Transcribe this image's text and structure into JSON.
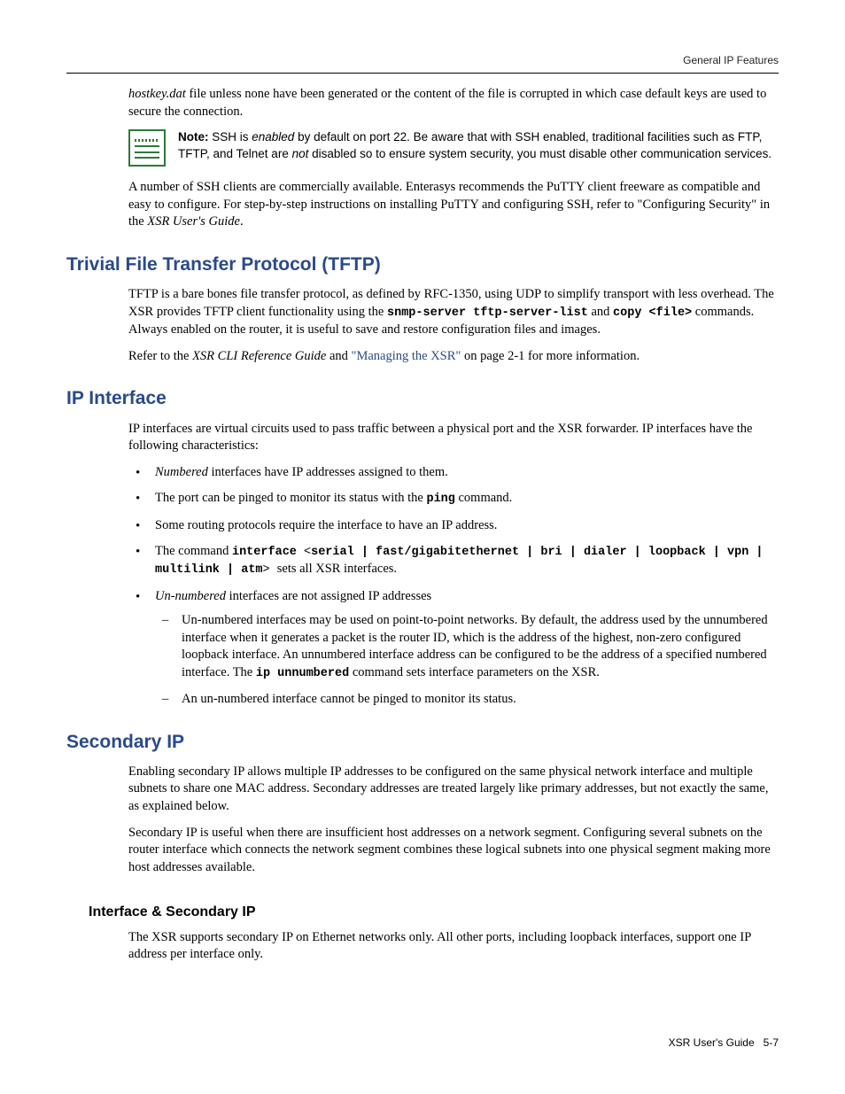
{
  "running_head": "General IP Features",
  "intro_p1_a": "hostkey.dat",
  "intro_p1_b": " file unless none have been generated or the content of the file is corrupted in which case default keys are used to secure the connection.",
  "note": {
    "label": "Note:",
    "t1": " SSH is ",
    "enabled": "enabled",
    "t2": " by default on port 22. Be aware that with SSH enabled, traditional facilities such as FTP, TFTP, and Telnet are ",
    "not": "not",
    "t3": " disabled so to ensure system security, you must disable other communication services."
  },
  "intro_p2_a": "A number of SSH clients are commercially available. Enterasys recommends the PuTTY client freeware as compatible and easy to configure. For step-by-step instructions on installing PuTTY and configuring SSH, refer to \"Configuring Security\" in the ",
  "intro_p2_b": "XSR User's Guide",
  "intro_p2_c": ".",
  "tftp": {
    "heading": "Trivial File Transfer Protocol (TFTP)",
    "p1_a": "TFTP is a bare bones file transfer protocol, as defined by RFC-1350, using UDP to simplify transport with less overhead. The XSR provides TFTP client functionality using the ",
    "p1_cmd1": "snmp-server tftp-server-list",
    "p1_b": " and ",
    "p1_cmd2": "copy <file>",
    "p1_c": " commands. Always enabled on the router, it is useful to save and restore configuration files and images.",
    "p2_a": "Refer to the ",
    "p2_b": "XSR CLI Reference Guide",
    "p2_c": " and ",
    "p2_link": "\"Managing the XSR\"",
    "p2_d": " on page 2-1 for more information."
  },
  "ipif": {
    "heading": "IP Interface",
    "p1": "IP interfaces are virtual circuits used to pass traffic between a physical port and the XSR forwarder. IP interfaces have the following characteristics:",
    "b1_a": "Numbered",
    "b1_b": " interfaces have IP addresses assigned to them.",
    "b2_a": "The port can be pinged to monitor its status with the ",
    "b2_cmd": "ping",
    "b2_b": " command.",
    "b3": "Some routing protocols require the interface to have an IP address.",
    "b4_a": "The command ",
    "b4_cmd": "interface",
    "b4_lt": " <",
    "b4_opts": "serial | fast/gigabitethernet | bri | dialer | loopback | vpn | multilink | atm",
    "b4_gt": "> ",
    "b4_b": "sets all XSR interfaces.",
    "b5_a": "Un-numbered",
    "b5_b": " interfaces are not assigned IP addresses",
    "d1_a": "Un-numbered interfaces may be used on point-to-point networks. By default, the address used by the unnumbered interface when it generates a packet is the router ID, which is the address of the highest, non-zero configured loopback interface. An unnumbered interface address can be configured to be the address of a specified numbered interface. The ",
    "d1_cmd": "ip unnumbered",
    "d1_b": " command sets interface parameters on the XSR.",
    "d2": "An un-numbered interface cannot be pinged to monitor its status."
  },
  "secip": {
    "heading": "Secondary IP",
    "p1": "Enabling secondary IP allows multiple IP addresses to be configured on the same physical network interface and multiple subnets to share one MAC address. Secondary addresses are treated largely like primary addresses, but not exactly the same, as explained below.",
    "p2": "Secondary IP is useful when there are insufficient host addresses on a network segment. Configuring several subnets on the router interface which connects the network segment combines these logical subnets into one physical segment making more host addresses available.",
    "sub_heading": "Interface & Secondary IP",
    "sub_p1": "The XSR supports secondary IP on Ethernet networks only. All other ports, including loopback interfaces, support one IP address per interface only."
  },
  "footer_a": "XSR User's Guide",
  "footer_b": "5-7"
}
